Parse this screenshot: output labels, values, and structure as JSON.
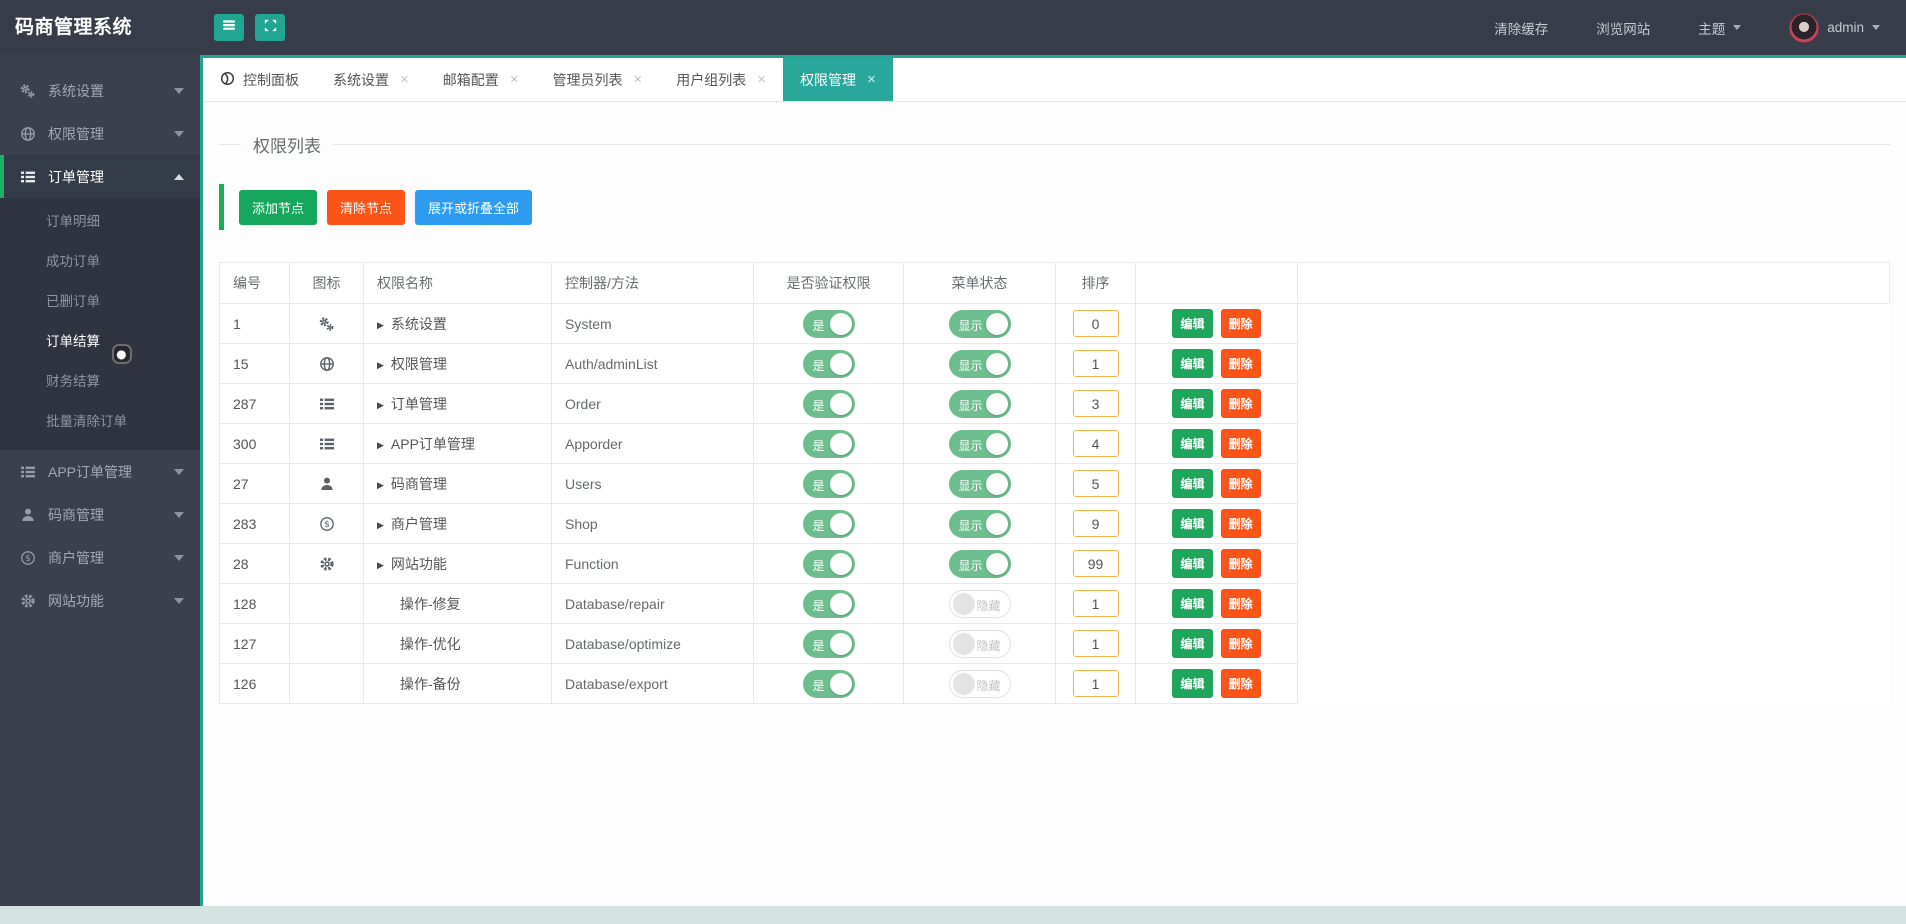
{
  "app": {
    "logo": "码商管理系统"
  },
  "navbar": {
    "buttons": [
      {
        "key": "menu",
        "icon": "menu-icon"
      },
      {
        "key": "fullscreen",
        "icon": "fullscreen-icon"
      }
    ],
    "links": [
      "清除缓存",
      "浏览网站"
    ],
    "theme_label": "主题",
    "user_name": "admin"
  },
  "sidebar": {
    "items": [
      {
        "key": "system-settings",
        "label": "系统设置",
        "icon": "gears-icon",
        "expanded": false
      },
      {
        "key": "auth",
        "label": "权限管理",
        "icon": "globe-icon",
        "expanded": false
      },
      {
        "key": "order",
        "label": "订单管理",
        "icon": "list-icon",
        "expanded": true,
        "children": [
          {
            "key": "order-detail",
            "label": "订单明细",
            "current": false
          },
          {
            "key": "order-success",
            "label": "成功订单",
            "current": false
          },
          {
            "key": "order-deleted",
            "label": "已删订单",
            "current": false
          },
          {
            "key": "order-settle",
            "label": "订单结算",
            "current": true
          },
          {
            "key": "finance-settle",
            "label": "财务结算",
            "current": false
          },
          {
            "key": "order-batch-clear",
            "label": "批量清除订单",
            "current": false
          }
        ]
      },
      {
        "key": "app-order",
        "label": "APP订单管理",
        "icon": "list-icon",
        "expanded": false
      },
      {
        "key": "code-merchant",
        "label": "码商管理",
        "icon": "user-icon",
        "expanded": false
      },
      {
        "key": "shop-merchant",
        "label": "商户管理",
        "icon": "dollar-icon",
        "expanded": false
      },
      {
        "key": "site-function",
        "label": "网站功能",
        "icon": "gear-icon",
        "expanded": false
      }
    ]
  },
  "tabs": [
    {
      "key": "dashboard",
      "label": "控制面板",
      "icon": "dashboard-icon",
      "closable": false,
      "active": false
    },
    {
      "key": "system-settings",
      "label": "系统设置",
      "closable": true,
      "active": false
    },
    {
      "key": "mail-config",
      "label": "邮箱配置",
      "closable": true,
      "active": false
    },
    {
      "key": "admin-list",
      "label": "管理员列表",
      "closable": true,
      "active": false
    },
    {
      "key": "user-group-list",
      "label": "用户组列表",
      "closable": true,
      "active": false
    },
    {
      "key": "auth-manage",
      "label": "权限管理",
      "closable": true,
      "active": true
    }
  ],
  "page": {
    "title": "权限列表",
    "toolbar": [
      {
        "key": "add-node",
        "label": "添加节点",
        "color": "#16a85a"
      },
      {
        "key": "clear-node",
        "label": "清除节点",
        "color": "#fa5419"
      },
      {
        "key": "toggle-all",
        "label": "展开或折叠全部",
        "color": "#2d9bf0"
      }
    ],
    "table": {
      "headers": [
        "编号",
        "图标",
        "权限名称",
        "控制器/方法",
        "是否验证权限",
        "菜单状态",
        "排序",
        ""
      ],
      "actions": {
        "edit": "编辑",
        "delete": "删除"
      },
      "rows": [
        {
          "id": "1",
          "icon": "gears-icon",
          "name": "系统设置",
          "expandable": true,
          "method": "System",
          "verify": "是",
          "menu": "显示",
          "menu_on": true,
          "sort": "0"
        },
        {
          "id": "15",
          "icon": "globe-icon",
          "name": "权限管理",
          "expandable": true,
          "method": "Auth/adminList",
          "verify": "是",
          "menu": "显示",
          "menu_on": true,
          "sort": "1"
        },
        {
          "id": "287",
          "icon": "list-icon",
          "name": "订单管理",
          "expandable": true,
          "method": "Order",
          "verify": "是",
          "menu": "显示",
          "menu_on": true,
          "sort": "3"
        },
        {
          "id": "300",
          "icon": "list-icon",
          "name": "APP订单管理",
          "expandable": true,
          "method": "Apporder",
          "verify": "是",
          "menu": "显示",
          "menu_on": true,
          "sort": "4"
        },
        {
          "id": "27",
          "icon": "user-icon",
          "name": "码商管理",
          "expandable": true,
          "method": "Users",
          "verify": "是",
          "menu": "显示",
          "menu_on": true,
          "sort": "5"
        },
        {
          "id": "283",
          "icon": "dollar-icon",
          "name": "商户管理",
          "expandable": true,
          "method": "Shop",
          "verify": "是",
          "menu": "显示",
          "menu_on": true,
          "sort": "9"
        },
        {
          "id": "28",
          "icon": "gear-icon",
          "name": "网站功能",
          "expandable": true,
          "method": "Function",
          "verify": "是",
          "menu": "显示",
          "menu_on": true,
          "sort": "99"
        },
        {
          "id": "128",
          "icon": "",
          "name": "操作-修复",
          "expandable": false,
          "method": "Database/repair",
          "verify": "是",
          "menu": "隐藏",
          "menu_on": false,
          "sort": "1"
        },
        {
          "id": "127",
          "icon": "",
          "name": "操作-优化",
          "expandable": false,
          "method": "Database/optimize",
          "verify": "是",
          "menu": "隐藏",
          "menu_on": false,
          "sort": "1"
        },
        {
          "id": "126",
          "icon": "",
          "name": "操作-备份",
          "expandable": false,
          "method": "Database/export",
          "verify": "是",
          "menu": "隐藏",
          "menu_on": false,
          "sort": "1"
        }
      ]
    }
  },
  "colors": {
    "accent_teal": "#21a695",
    "active_tab": "#2aa79b",
    "sidebar_bg": "#3a404d",
    "navbar_bg": "#363c49",
    "submenu_bg": "#2f3440",
    "active_item_bar": "#1fae66",
    "btn_green": "#16a85a",
    "btn_orange": "#fa5419",
    "btn_blue": "#2d9bf0",
    "toggle_green": "#6cbe8c",
    "sort_border": "#f5b14c",
    "footer_strip": "#d3e3df"
  }
}
